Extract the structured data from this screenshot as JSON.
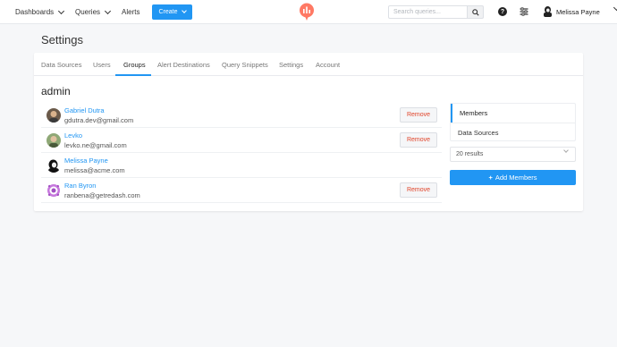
{
  "nav": {
    "dashboards": "Dashboards",
    "queries": "Queries",
    "alerts": "Alerts",
    "create": "Create",
    "search_placeholder": "Search queries...",
    "user_name": "Melissa Payne"
  },
  "page": {
    "title": "Settings"
  },
  "tabs": [
    {
      "label": "Data Sources"
    },
    {
      "label": "Users"
    },
    {
      "label": "Groups"
    },
    {
      "label": "Alert Destinations"
    },
    {
      "label": "Query Snippets"
    },
    {
      "label": "Settings"
    },
    {
      "label": "Account"
    }
  ],
  "group": {
    "name": "admin"
  },
  "members": [
    {
      "name": "Gabriel Dutra",
      "email": "gdutra.dev@gmail.com",
      "remove_label": "Remove"
    },
    {
      "name": "Levko",
      "email": "levko.ne@gmail.com",
      "remove_label": "Remove"
    },
    {
      "name": "Melissa Payne",
      "email": "melissa@acme.com"
    },
    {
      "name": "Ran Byron",
      "email": "ranbena@getredash.com",
      "remove_label": "Remove"
    }
  ],
  "sidebar": {
    "items": [
      {
        "label": "Members"
      },
      {
        "label": "Data Sources"
      }
    ],
    "results": "20 results",
    "add_label": "Add Members"
  },
  "colors": {
    "accent": "#2196f3",
    "danger": "#e0442a",
    "logo": "#ff7964"
  }
}
